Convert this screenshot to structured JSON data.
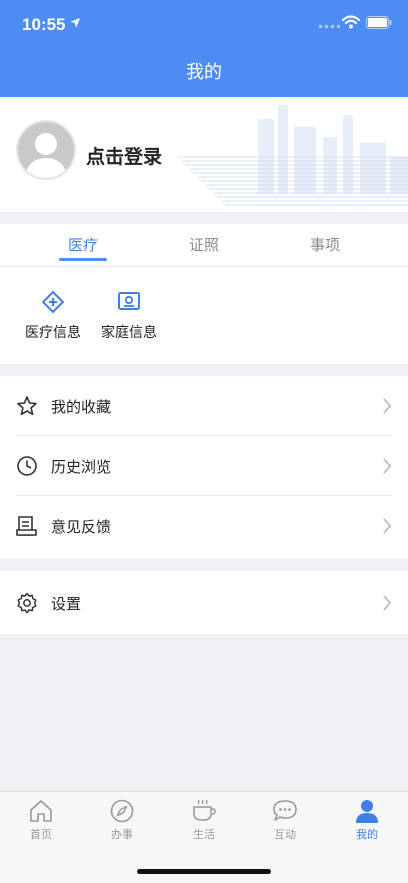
{
  "status": {
    "time": "10:55"
  },
  "header": {
    "title": "我的"
  },
  "profile": {
    "login_label": "点击登录"
  },
  "tabs": [
    {
      "label": "医疗",
      "active": true
    },
    {
      "label": "证照",
      "active": false
    },
    {
      "label": "事项",
      "active": false
    }
  ],
  "shortcuts": [
    {
      "label": "医疗信息",
      "icon": "medical-info-icon"
    },
    {
      "label": "家庭信息",
      "icon": "family-info-icon"
    }
  ],
  "menu": [
    {
      "label": "我的收藏",
      "icon": "star-icon"
    },
    {
      "label": "历史浏览",
      "icon": "clock-icon"
    },
    {
      "label": "意见反馈",
      "icon": "feedback-icon"
    }
  ],
  "settings": {
    "label": "设置",
    "icon": "gear-icon"
  },
  "bottom_nav": [
    {
      "label": "首页",
      "icon": "home-icon",
      "active": false
    },
    {
      "label": "办事",
      "icon": "compass-icon",
      "active": false
    },
    {
      "label": "生活",
      "icon": "coffee-icon",
      "active": false
    },
    {
      "label": "互动",
      "icon": "chat-icon",
      "active": false
    },
    {
      "label": "我的",
      "icon": "user-icon",
      "active": true
    }
  ],
  "colors": {
    "primary": "#4c8cf3",
    "text": "#222222",
    "muted": "#8a8a8a"
  }
}
